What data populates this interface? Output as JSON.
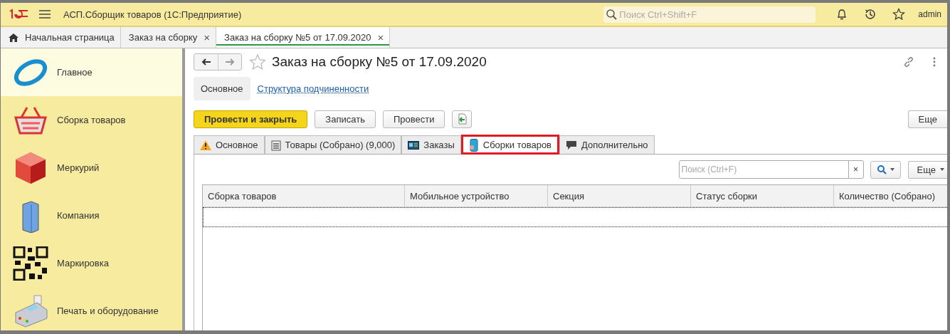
{
  "app_bar": {
    "title": "АСП.Сборщик товаров  (1С:Предприятие)",
    "search": {
      "placeholder": "Поиск Ctrl+Shift+F"
    },
    "user": "admin"
  },
  "window_tabs": [
    {
      "label": "Начальная страница",
      "kind": "home",
      "selected": false
    },
    {
      "label": "Заказ на сборку",
      "kind": "closable",
      "selected": false
    },
    {
      "label": "Заказ на сборку №5 от 17.09.2020",
      "kind": "closable",
      "selected": true
    }
  ],
  "close_glyph": "×",
  "sidebar": {
    "items": [
      {
        "label": "Главное",
        "kind": "main",
        "selected": true
      },
      {
        "label": "Сборка товаров",
        "kind": "basket",
        "selected": false
      },
      {
        "label": "Меркурий",
        "kind": "cube",
        "selected": false
      },
      {
        "label": "Компания",
        "kind": "building",
        "selected": false
      },
      {
        "label": "Маркировка",
        "kind": "qr",
        "selected": false
      },
      {
        "label": "Печать и оборудование",
        "kind": "terminal",
        "selected": false
      }
    ]
  },
  "document": {
    "title": "Заказ на сборку №5 от 17.09.2020",
    "nav_links": [
      {
        "label": "Основное",
        "selected": true
      },
      {
        "label": "Структура подчиненности",
        "selected": false
      }
    ],
    "buttons": [
      {
        "label": "Провести и закрыть",
        "kind": "primary"
      },
      {
        "label": "Записать",
        "kind": "normal"
      },
      {
        "label": "Провести",
        "kind": "normal"
      },
      {
        "kind": "icon"
      }
    ],
    "more_button": "Еще",
    "tabs": [
      {
        "label": "Основное",
        "kind": "warning",
        "selected": false,
        "highlighted": false
      },
      {
        "label": "Товары (Собрано) (9,000)",
        "kind": "list",
        "selected": false,
        "highlighted": false
      },
      {
        "label": "Заказы",
        "kind": "card",
        "selected": false,
        "highlighted": false
      },
      {
        "label": "Сборки товаров",
        "kind": "phone",
        "selected": true,
        "highlighted": true
      },
      {
        "label": "Дополнительно",
        "kind": "chat",
        "selected": false,
        "highlighted": false
      }
    ],
    "table_search": {
      "placeholder": "Поиск (Ctrl+F)",
      "clear": "×"
    },
    "table_more": "Еще",
    "table": {
      "columns": [
        "Сборка товаров",
        "Мобильное устройство",
        "Секция",
        "Статус сборки",
        "Количество (Собрано)"
      ]
    }
  }
}
